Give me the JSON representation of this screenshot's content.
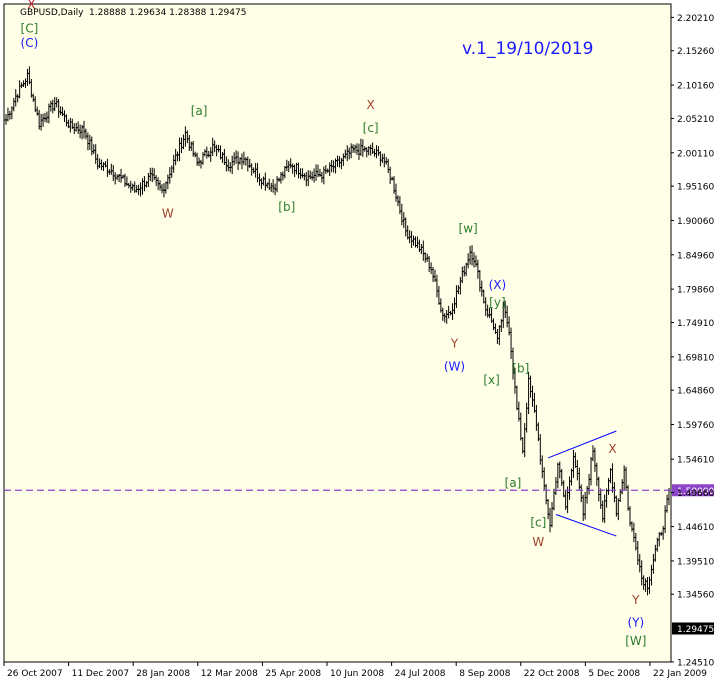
{
  "header": {
    "symbol": "GBPUSD,Daily",
    "ohlc": "1.28888 1.29634 1.28388 1.29475"
  },
  "version_label": "v.1_19/10/2019",
  "colors": {
    "background": "#ffffe7",
    "bars": "#000000",
    "level_line": "#8e44c8",
    "wave_green": "#2e7d2e",
    "wave_blue": "#1a1aff",
    "wave_red": "#a0402a",
    "wave_dark_red": "#c0202a",
    "channel": "#0000ff",
    "current_price_box": "#000000"
  },
  "chart_data": {
    "type": "ohlc",
    "symbol": "GBPUSD",
    "timeframe": "Daily",
    "y_ticks": [
      "2.20210",
      "2.15260",
      "2.10160",
      "2.05210",
      "2.00110",
      "1.95160",
      "1.90060",
      "1.84960",
      "1.79860",
      "1.74910",
      "1.69810",
      "1.64860",
      "1.59760",
      "1.54610",
      "1.49660",
      "1.44610",
      "1.39510",
      "1.34560",
      "1.29475",
      "1.24510"
    ],
    "x_ticks": [
      "26 Oct 2007",
      "11 Dec 2007",
      "28 Jan 2008",
      "12 Mar 2008",
      "25 Apr 2008",
      "10 Jun 2008",
      "24 Jul 2008",
      "8 Sep 2008",
      "22 Oct 2008",
      "5 Dec 2008",
      "22 Jan 2009"
    ],
    "ylim": [
      1.245,
      2.222
    ],
    "close_path": [
      {
        "i": 0,
        "p": 2.05
      },
      {
        "i": 5,
        "p": 2.085
      },
      {
        "i": 11,
        "p": 2.115
      },
      {
        "i": 17,
        "p": 2.045
      },
      {
        "i": 25,
        "p": 2.075
      },
      {
        "i": 33,
        "p": 2.04
      },
      {
        "i": 40,
        "p": 2.035
      },
      {
        "i": 47,
        "p": 1.985
      },
      {
        "i": 54,
        "p": 1.975
      },
      {
        "i": 60,
        "p": 1.96
      },
      {
        "i": 66,
        "p": 1.945
      },
      {
        "i": 74,
        "p": 1.965
      },
      {
        "i": 80,
        "p": 1.945
      },
      {
        "i": 85,
        "p": 1.98
      },
      {
        "i": 92,
        "p": 2.03
      },
      {
        "i": 98,
        "p": 1.985
      },
      {
        "i": 106,
        "p": 2.01
      },
      {
        "i": 114,
        "p": 1.985
      },
      {
        "i": 122,
        "p": 1.995
      },
      {
        "i": 130,
        "p": 1.965
      },
      {
        "i": 137,
        "p": 1.95
      },
      {
        "i": 146,
        "p": 1.985
      },
      {
        "i": 155,
        "p": 1.965
      },
      {
        "i": 163,
        "p": 1.97
      },
      {
        "i": 170,
        "p": 1.985
      },
      {
        "i": 178,
        "p": 2.005
      },
      {
        "i": 186,
        "p": 2.005
      },
      {
        "i": 193,
        "p": 1.995
      },
      {
        "i": 198,
        "p": 1.96
      },
      {
        "i": 205,
        "p": 1.885
      },
      {
        "i": 212,
        "p": 1.86
      },
      {
        "i": 218,
        "p": 1.83
      },
      {
        "i": 224,
        "p": 1.76
      },
      {
        "i": 228,
        "p": 1.765
      },
      {
        "i": 233,
        "p": 1.81
      },
      {
        "i": 238,
        "p": 1.855
      },
      {
        "i": 240,
        "p": 1.845
      },
      {
        "i": 246,
        "p": 1.77
      },
      {
        "i": 250,
        "p": 1.745
      },
      {
        "i": 252,
        "p": 1.72
      },
      {
        "i": 255,
        "p": 1.77
      },
      {
        "i": 258,
        "p": 1.74
      },
      {
        "i": 262,
        "p": 1.62
      },
      {
        "i": 265,
        "p": 1.56
      },
      {
        "i": 268,
        "p": 1.66
      },
      {
        "i": 272,
        "p": 1.6
      },
      {
        "i": 276,
        "p": 1.5
      },
      {
        "i": 279,
        "p": 1.45
      },
      {
        "i": 283,
        "p": 1.54
      },
      {
        "i": 287,
        "p": 1.475
      },
      {
        "i": 291,
        "p": 1.555
      },
      {
        "i": 296,
        "p": 1.465
      },
      {
        "i": 301,
        "p": 1.56
      },
      {
        "i": 306,
        "p": 1.46
      },
      {
        "i": 310,
        "p": 1.53
      },
      {
        "i": 313,
        "p": 1.47
      },
      {
        "i": 317,
        "p": 1.53
      },
      {
        "i": 320,
        "p": 1.45
      },
      {
        "i": 323,
        "p": 1.42
      },
      {
        "i": 326,
        "p": 1.37
      },
      {
        "i": 329,
        "p": 1.36
      },
      {
        "i": 333,
        "p": 1.41
      },
      {
        "i": 337,
        "p": 1.45
      },
      {
        "i": 340,
        "p": 1.495
      }
    ],
    "horizontal_line": {
      "price": 1.5,
      "label": "1.50000"
    },
    "current_price": {
      "price": 1.29475,
      "label": "1.29475"
    },
    "channel_lines": [
      {
        "from": {
          "i": 278,
          "p": 1.548
        },
        "to": {
          "i": 313,
          "p": 1.588
        }
      },
      {
        "from": {
          "i": 282,
          "p": 1.464
        },
        "to": {
          "i": 313,
          "p": 1.432
        }
      }
    ],
    "wave_labels": [
      {
        "text": "X",
        "i": 13,
        "p": 2.215,
        "color": "wave_dark_red"
      },
      {
        "text": "[C]",
        "i": 12,
        "p": 2.18,
        "color": "wave_green"
      },
      {
        "text": "(C)",
        "i": 12,
        "p": 2.158,
        "color": "wave_blue"
      },
      {
        "text": "W",
        "i": 83,
        "p": 1.905,
        "color": "wave_red"
      },
      {
        "text": "[a]",
        "i": 99,
        "p": 2.057,
        "color": "wave_green"
      },
      {
        "text": "[b]",
        "i": 144,
        "p": 1.915,
        "color": "wave_green"
      },
      {
        "text": "X",
        "i": 187,
        "p": 2.066,
        "color": "wave_red"
      },
      {
        "text": "[c]",
        "i": 187,
        "p": 2.032,
        "color": "wave_green"
      },
      {
        "text": "[w]",
        "i": 237,
        "p": 1.883,
        "color": "wave_green"
      },
      {
        "text": "(X)",
        "i": 252,
        "p": 1.799,
        "color": "wave_blue"
      },
      {
        "text": "[y]",
        "i": 252,
        "p": 1.773,
        "color": "wave_green"
      },
      {
        "text": "Y",
        "i": 230,
        "p": 1.712,
        "color": "wave_red"
      },
      {
        "text": "(W)",
        "i": 230,
        "p": 1.678,
        "color": "wave_blue"
      },
      {
        "text": "[x]",
        "i": 249,
        "p": 1.658,
        "color": "wave_green"
      },
      {
        "text": "[b]",
        "i": 264,
        "p": 1.675,
        "color": "wave_green"
      },
      {
        "text": "[a]",
        "i": 260,
        "p": 1.505,
        "color": "wave_green"
      },
      {
        "text": "[c]",
        "i": 273,
        "p": 1.446,
        "color": "wave_green"
      },
      {
        "text": "W",
        "i": 273,
        "p": 1.417,
        "color": "wave_red"
      },
      {
        "text": "X",
        "i": 311,
        "p": 1.555,
        "color": "wave_red"
      },
      {
        "text": "Y",
        "i": 323,
        "p": 1.331,
        "color": "wave_red"
      },
      {
        "text": "(Y)",
        "i": 323,
        "p": 1.298,
        "color": "wave_blue"
      },
      {
        "text": "[W]",
        "i": 323,
        "p": 1.27,
        "color": "wave_green"
      }
    ],
    "grid": false
  }
}
